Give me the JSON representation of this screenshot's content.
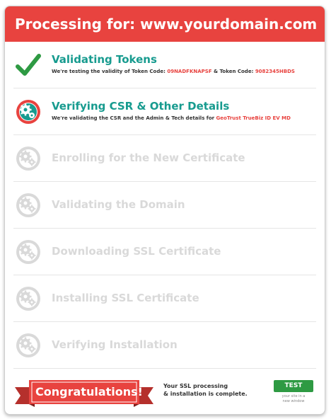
{
  "header": {
    "title": "Processing for: www.yourdomain.com"
  },
  "colors": {
    "brand_red": "#e8433f",
    "teal": "#179b8f",
    "check_green": "#2e9a43",
    "pending_gray": "#d9d9d9"
  },
  "steps": [
    {
      "status": "done",
      "icon": "checkmark-icon",
      "title": "Validating Tokens",
      "desc_pre": "We're testing the validity of Token Code: ",
      "token1": "09NADFKNAPSF",
      "desc_mid": " & Token Code: ",
      "token2": "9082345HBDS"
    },
    {
      "status": "active",
      "icon": "gears-icon",
      "title": "Verifying CSR & Other Details",
      "desc_pre": "We're validating the CSR and the Admin & Tech details for ",
      "product": "GeoTrust TrueBiz ID EV MD"
    },
    {
      "status": "pending",
      "icon": "gears-icon",
      "title": "Enrolling for the New Certificate"
    },
    {
      "status": "pending",
      "icon": "gears-icon",
      "title": "Validating the Domain"
    },
    {
      "status": "pending",
      "icon": "gears-icon",
      "title": "Downloading SSL Certificate"
    },
    {
      "status": "pending",
      "icon": "gears-icon",
      "title": "Installing SSL Certificate"
    },
    {
      "status": "pending",
      "icon": "gears-icon",
      "title": "Verifying Installation"
    }
  ],
  "footer": {
    "ribbon_text": "Congratulations!",
    "message_line1": "Your SSL processing",
    "message_line2": "& installation is complete.",
    "test_button": "TEST",
    "test_note_line1": "your site in a",
    "test_note_line2": "new window"
  }
}
